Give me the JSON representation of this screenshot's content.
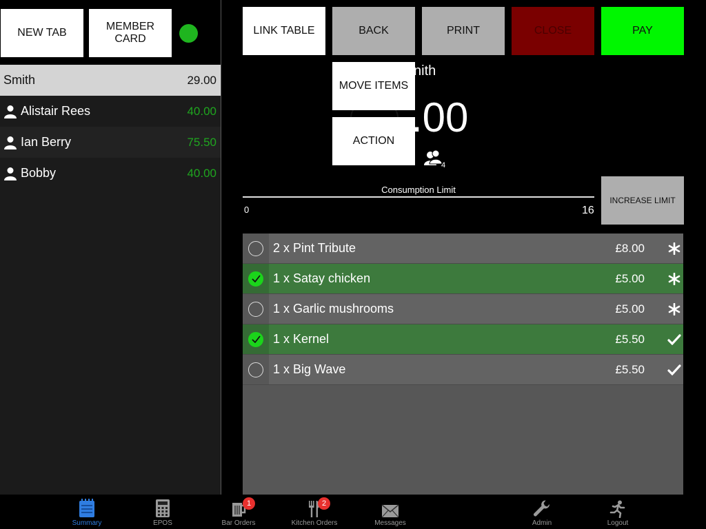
{
  "left_panel": {
    "new_tab_label": "NEW TAB",
    "member_card_label_line1": "MEMBER",
    "member_card_label_line2": "CARD",
    "tabs": [
      {
        "name": "Smith",
        "amount": "29.00"
      },
      {
        "name": "Alistair Rees",
        "amount": "40.00"
      },
      {
        "name": "Ian Berry",
        "amount": "75.50"
      },
      {
        "name": "Bobby",
        "amount": "40.00"
      }
    ]
  },
  "toolbar": {
    "link_table": "LINK TABLE",
    "back": "BACK",
    "print": "PRINT",
    "close": "CLOSE",
    "pay": "PAY"
  },
  "dropdown": {
    "move_items": "MOVE ITEMS",
    "action": "ACTION"
  },
  "tab_detail": {
    "title_visible": "nith",
    "total_visible": ".00",
    "guest_count": "4"
  },
  "consumption": {
    "label": "Consumption Limit",
    "min": "0",
    "max": "16",
    "increase_label": "INCREASE LIMIT"
  },
  "items": [
    {
      "desc": "2 x Pint Tribute",
      "price": "£8.00",
      "selected": false,
      "status": "asterisk"
    },
    {
      "desc": "1 x Satay chicken",
      "price": "£5.00",
      "selected": true,
      "status": "asterisk"
    },
    {
      "desc": "1 x Garlic mushrooms",
      "price": "£5.00",
      "selected": false,
      "status": "asterisk"
    },
    {
      "desc": "1 x Kernel",
      "price": "£5.50",
      "selected": true,
      "status": "check"
    },
    {
      "desc": "1 x Big Wave",
      "price": "£5.50",
      "selected": false,
      "status": "check"
    }
  ],
  "bottom_nav": [
    {
      "label": "Summary",
      "icon": "notepad-icon",
      "active": true
    },
    {
      "label": "EPOS",
      "icon": "calculator-icon",
      "active": false
    },
    {
      "label": "Bar Orders",
      "icon": "beer-icon",
      "badge": "1",
      "active": false
    },
    {
      "label": "Kitchen Orders",
      "icon": "cutlery-icon",
      "badge": "2",
      "active": false
    },
    {
      "label": "Messages",
      "icon": "envelope-icon",
      "active": false
    },
    {
      "label": "Admin",
      "icon": "wrench-icon",
      "active": false
    },
    {
      "label": "Logout",
      "icon": "running-man-icon",
      "active": false
    }
  ],
  "colors": {
    "accent_green": "#00f700",
    "close_red": "#7a0000",
    "active_blue": "#2f7de1",
    "amount_green": "#1fa51f"
  }
}
